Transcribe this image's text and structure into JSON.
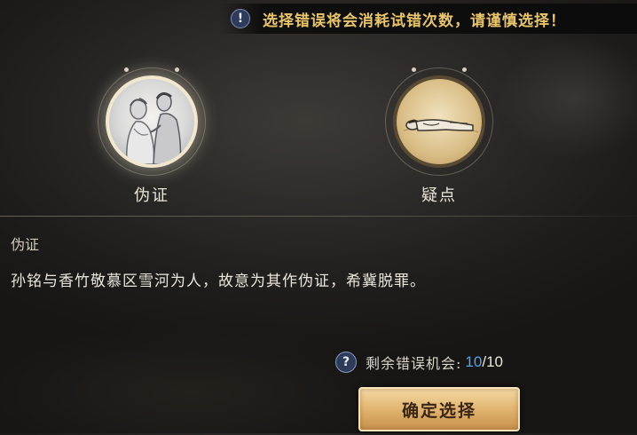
{
  "warning": {
    "icon": "exclamation-icon",
    "text": "选择错误将会消耗试错次数，请谨慎选择！"
  },
  "clues": [
    {
      "label": "伪证",
      "image": "two-figures-sketch",
      "selected": true
    },
    {
      "label": "疑点",
      "image": "lying-figure-sketch",
      "selected": false
    }
  ],
  "detail": {
    "title": "伪证",
    "text": "孙铭与香竹敬慕区雪河为人，故意为其作伪证，希冀脱罪。"
  },
  "chances": {
    "icon": "question-icon",
    "label": "剩余错误机会:",
    "current": "10",
    "separator": "/",
    "max": "10"
  },
  "confirm_label": "确定选择",
  "colors": {
    "warning_text": "#e8c46c",
    "chances_current": "#4fa6f0",
    "button_gold": "#e3b874"
  }
}
